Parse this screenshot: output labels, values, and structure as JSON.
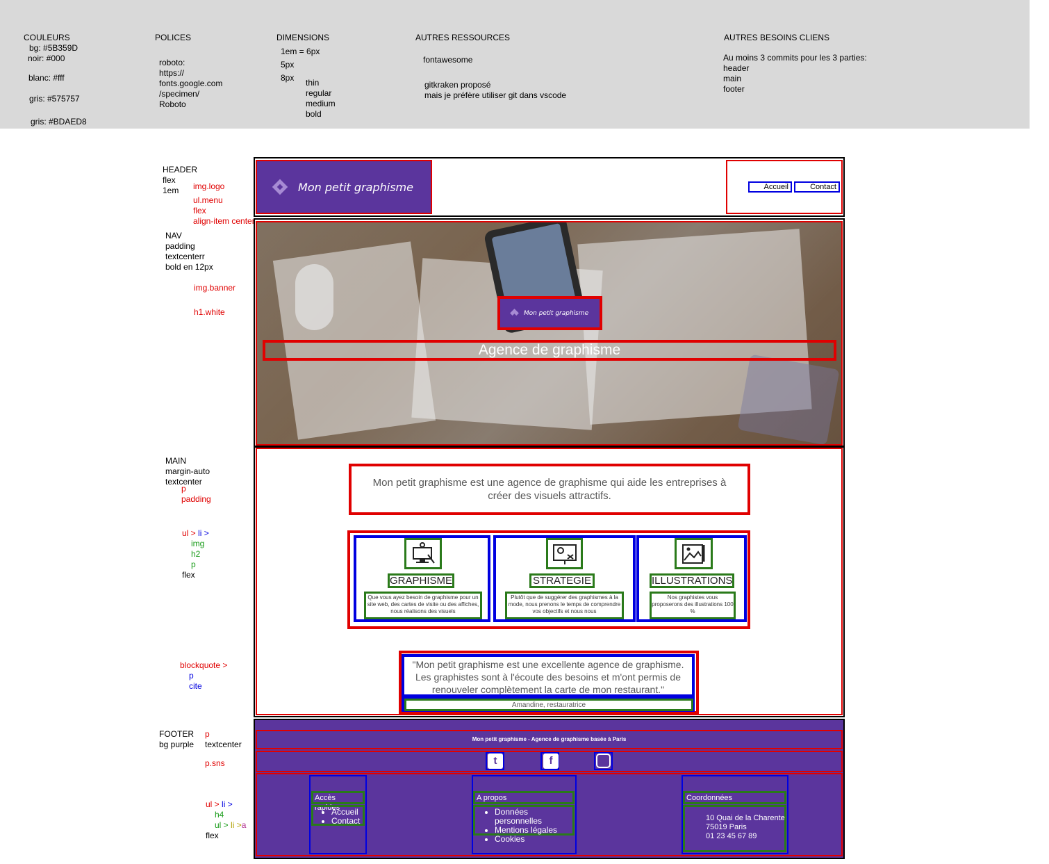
{
  "spec": {
    "couleurs": {
      "title": "COULEURS",
      "bg": "bg: #5B359D",
      "noir": "noir: #000",
      "blanc": "blanc: #fff",
      "gris1": "gris: #575757",
      "gris2": "gris: #BDAED8"
    },
    "polices": {
      "title": "POLICES",
      "lines": [
        "roboto:",
        "https://",
        "fonts.google.com",
        "/specimen/",
        "Roboto"
      ]
    },
    "dimensions": {
      "title": "DIMENSIONS",
      "em": "1em = 6px",
      "px5": "5px",
      "px8": "8px",
      "weights": [
        "thin",
        "regular",
        "medium",
        "bold"
      ]
    },
    "ressources": {
      "title": "AUTRES RESSOURCES",
      "fontawesome": "fontawesome",
      "git1": "gitkraken proposé",
      "git2": "mais je préfère utiliser git dans vscode"
    },
    "besoins": {
      "title": "AUTRES BESOINS CLIENS",
      "lines": [
        "Au moins 3 commits pour les 3 parties:",
        "header",
        "main",
        "footer"
      ]
    }
  },
  "notes": {
    "header": [
      "HEADER",
      "flex",
      "1em"
    ],
    "header_red": [
      "img.logo",
      "ul.menu",
      "flex",
      "align-item center"
    ],
    "nav": [
      "NAV",
      "padding",
      "textcenterr",
      "bold en 12px"
    ],
    "nav_red": [
      "img.banner",
      "h1.white"
    ],
    "main": [
      "MAIN",
      "margin-auto",
      "textcenter"
    ],
    "main_red": [
      "p",
      "padding"
    ],
    "ul_red": "ul >",
    "ul_blue": "li >",
    "ul_green": [
      "img",
      "h2",
      "p"
    ],
    "ul_flex": "flex",
    "bq_red": "blockquote >",
    "bq_blue": [
      "p",
      "cite"
    ],
    "footer": [
      "FOOTER",
      "bg purple"
    ],
    "footer_red_p": "p",
    "footer_textcenter": "textcenter",
    "footer_sns": "p.sns",
    "footer_ul_red": "ul >",
    "footer_li_blue": "li >",
    "footer_h4": "h4",
    "footer_ul2_a": "ul >",
    "footer_ul2_b": "li >",
    "footer_ul2_c": "a",
    "footer_flex": "flex"
  },
  "site": {
    "logo_text": "Mon petit graphisme",
    "menu": [
      "Accueil",
      "Contact"
    ],
    "banner_logo_text": "Mon petit graphisme",
    "h1": "Agence de graphisme",
    "intro": "Mon petit graphisme est une agence de graphisme qui aide les entreprises à créer des visuels attractifs.",
    "cards": [
      {
        "icon": "design-computer-icon",
        "title": "GRAPHISME",
        "text": "Que vous ayez besoin de graphisme pour un site web, des cartes de visite ou des affiches, nous réalisons des visuels"
      },
      {
        "icon": "strategy-board-icon",
        "title": "STRATEGIE",
        "text": "Plutôt que de suggérer des graphismes à la mode, nous prenons le temps de comprendre vos objectifs et nous nous"
      },
      {
        "icon": "illustration-image-icon",
        "title": "ILLUSTRATIONS",
        "text": "Nos graphistes vous proposerons des illustrations 100 %"
      }
    ],
    "quote": "\"Mon petit graphisme est une excellente agence de graphisme. Les graphistes sont à l'écoute des besoins et m'ont permis de renouveler complètement la carte de mon restaurant.\"",
    "cite": "Amandine, restauratrice",
    "footer_tagline": "Mon petit graphisme - Agence de graphisme basée à Paris",
    "sns": [
      "twitter-icon",
      "facebook-icon",
      "instagram-icon"
    ],
    "footer_cols": [
      {
        "title": "Accès rapides",
        "items": [
          "Accueil",
          "Contact"
        ]
      },
      {
        "title": "A propos",
        "items": [
          "Données personnelles",
          "Mentions légales",
          "Cookies"
        ]
      },
      {
        "title": "Coordonnées",
        "lines": [
          "10 Quai de la Charente",
          "75019 Paris",
          "01 23 45 67 89"
        ]
      }
    ]
  }
}
